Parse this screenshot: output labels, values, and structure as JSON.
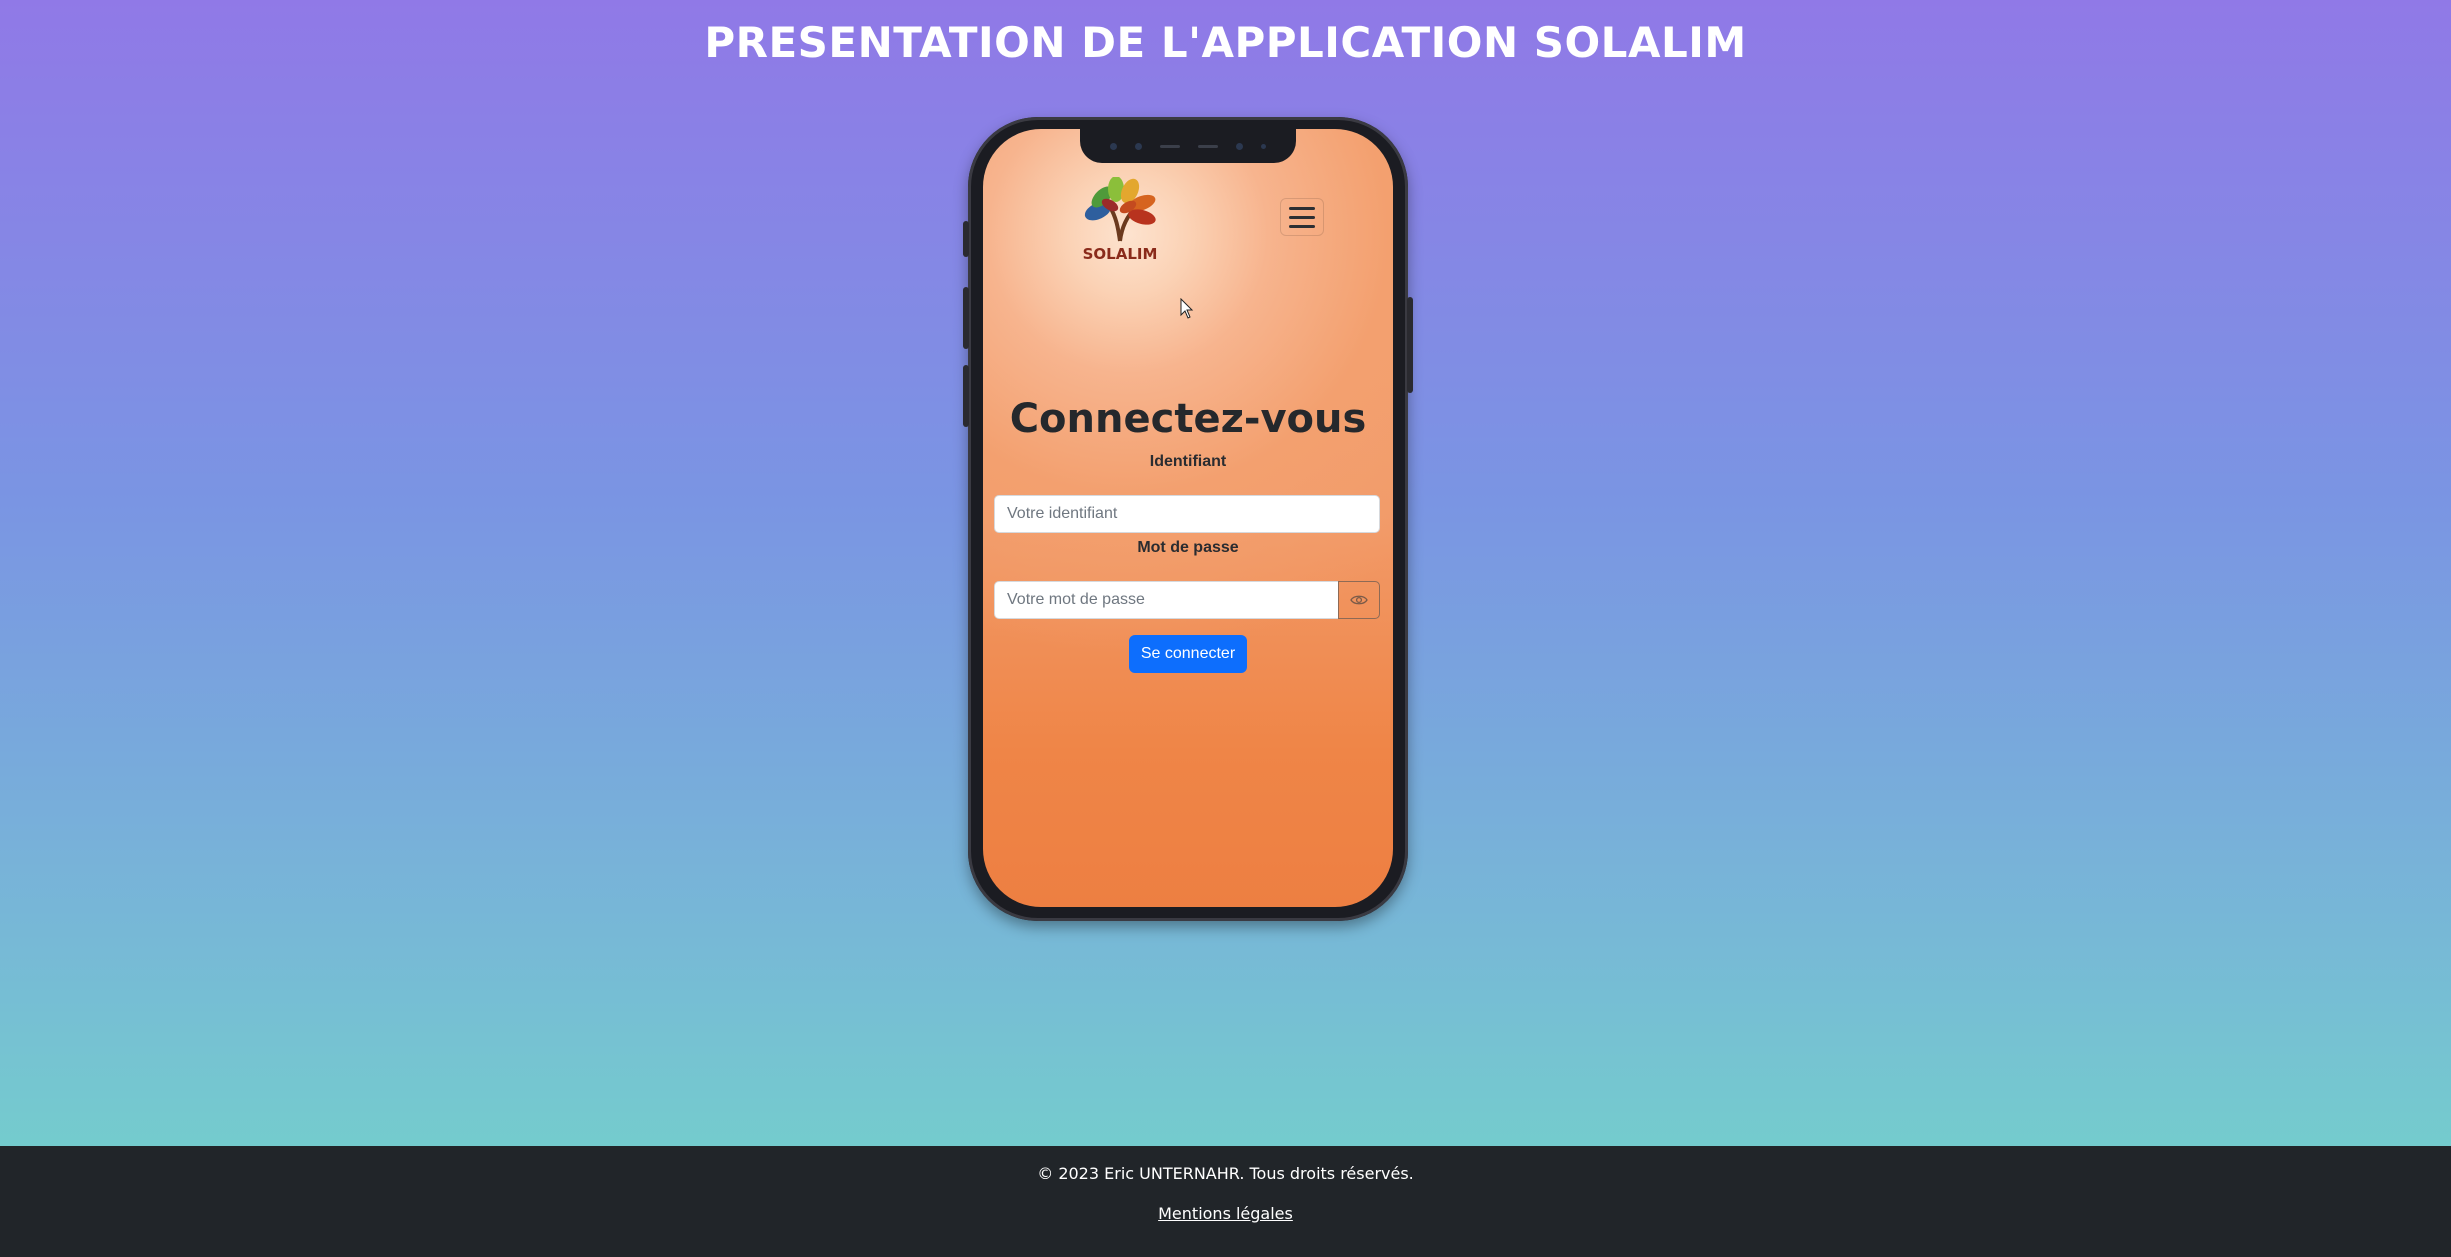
{
  "page": {
    "title": "PRESENTATION DE L'APPLICATION SOLALIM"
  },
  "app": {
    "logo_text": "SOLALIM",
    "login": {
      "title": "Connectez-vous",
      "username_label": "Identifiant",
      "username_placeholder": "Votre identifiant",
      "password_label": "Mot de passe",
      "password_placeholder": "Votre mot de passe",
      "submit_label": "Se connecter"
    },
    "icons": {
      "menu": "hamburger-menu-icon",
      "password_toggle": "eye-icon",
      "logo": "tree-logo"
    },
    "colors": {
      "primary_button": "#0d6efd",
      "screen_background": "#f29a68",
      "title_text": "#25282c"
    }
  },
  "footer": {
    "copyright": "© 2023 Eric UNTERNAHR. Tous droits réservés.",
    "legal_link": "Mentions légales"
  }
}
